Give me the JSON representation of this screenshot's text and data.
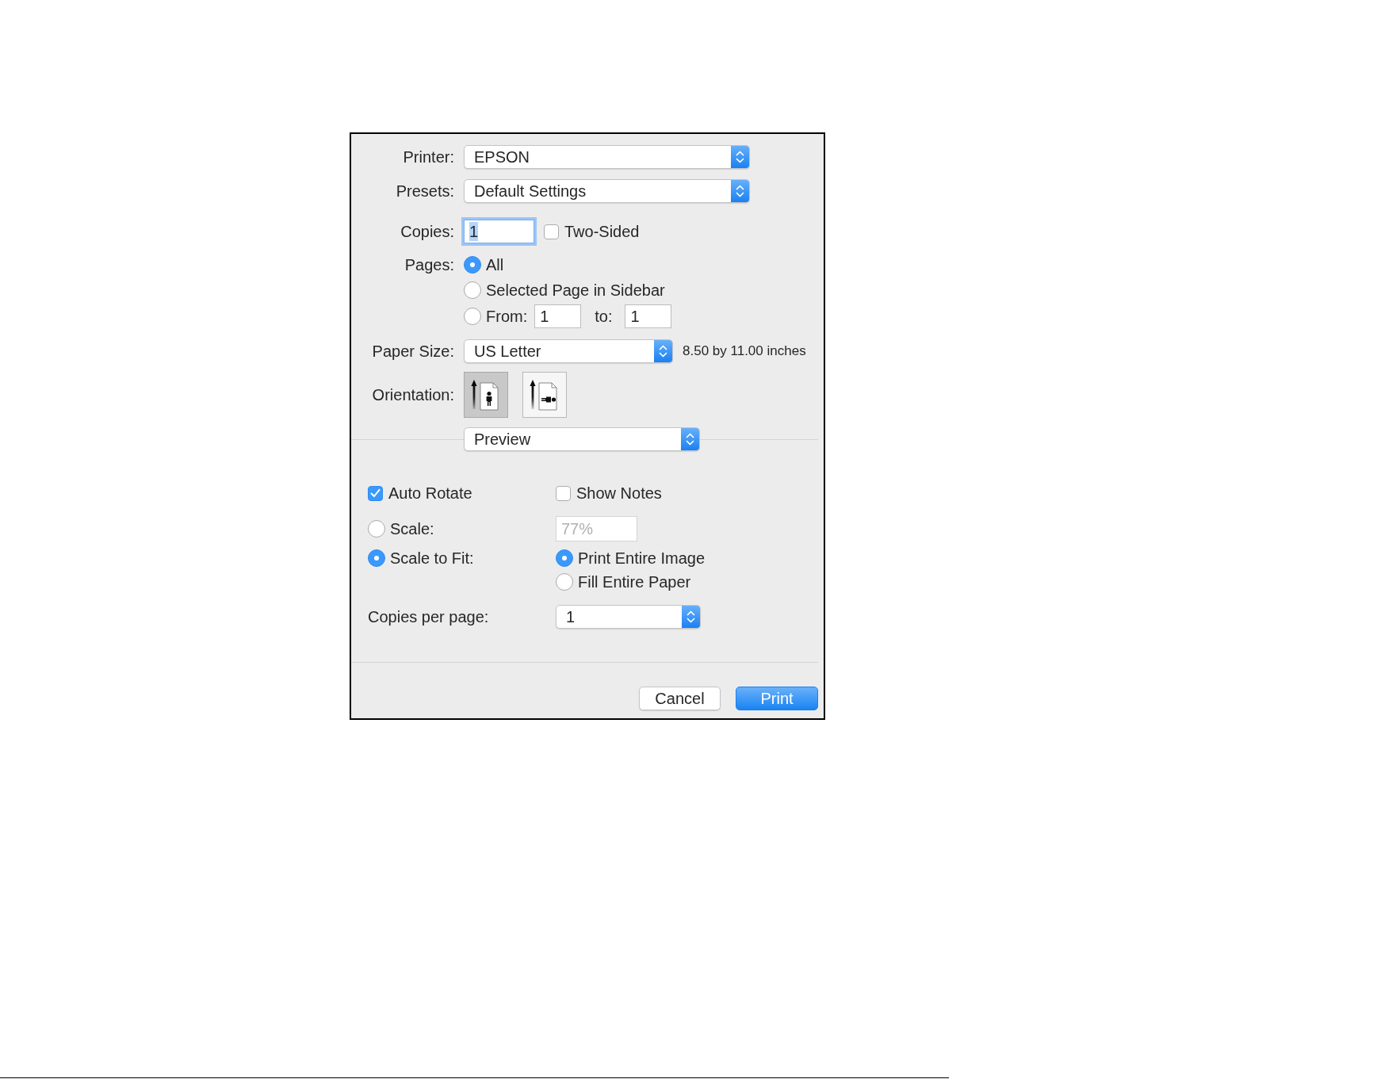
{
  "printer": {
    "label": "Printer:",
    "value": "EPSON"
  },
  "presets": {
    "label": "Presets:",
    "value": "Default Settings"
  },
  "copies": {
    "label": "Copies:",
    "value": "1",
    "focused": true,
    "two_sided": {
      "label": "Two-Sided",
      "checked": false
    }
  },
  "pages": {
    "label": "Pages:",
    "options": [
      {
        "kind": "all",
        "label": "All",
        "selected": true
      },
      {
        "kind": "sidebar",
        "label": "Selected Page in Sidebar",
        "selected": false
      },
      {
        "kind": "range",
        "label": "From:",
        "selected": false,
        "from": "1",
        "to_label": "to:",
        "to": "1"
      }
    ]
  },
  "paper_size": {
    "label": "Paper Size:",
    "value": "US Letter",
    "dimensions": "8.50 by 11.00 inches"
  },
  "orientation": {
    "label": "Orientation:",
    "options": [
      {
        "kind": "portrait",
        "selected": true
      },
      {
        "kind": "landscape",
        "selected": false
      }
    ]
  },
  "panel_menu": {
    "value": "Preview"
  },
  "preview": {
    "auto_rotate": {
      "label": "Auto Rotate",
      "checked": true
    },
    "show_notes": {
      "label": "Show Notes",
      "checked": false
    },
    "scaling": [
      {
        "kind": "scale",
        "label": "Scale:",
        "selected": false,
        "value": "77%",
        "disabled": true
      },
      {
        "kind": "fit",
        "label": "Scale to Fit:",
        "selected": true,
        "options": [
          {
            "label": "Print Entire Image",
            "selected": true
          },
          {
            "label": "Fill Entire Paper",
            "selected": false
          }
        ]
      }
    ],
    "copies_per_page": {
      "label": "Copies per page:",
      "value": "1"
    }
  },
  "buttons": [
    {
      "kind": "default",
      "label": "Cancel"
    },
    {
      "kind": "primary",
      "label": "Print"
    }
  ]
}
